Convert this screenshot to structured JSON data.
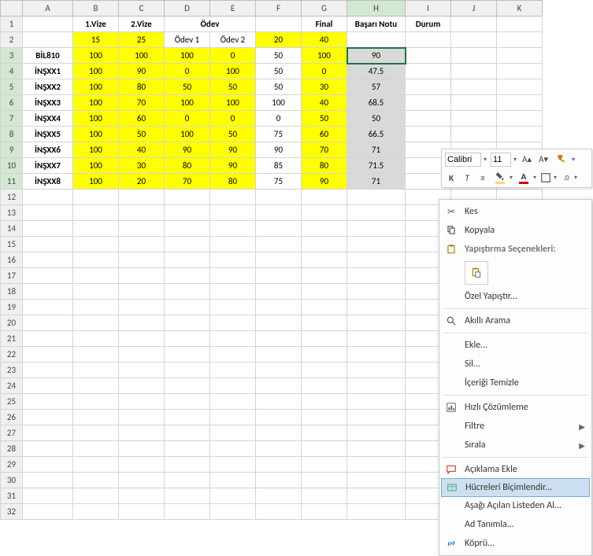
{
  "columns": [
    "A",
    "B",
    "C",
    "D",
    "E",
    "F",
    "G",
    "H",
    "I",
    "J",
    "K"
  ],
  "row_count": 32,
  "headers": {
    "A_blank": "",
    "vize1": "1.Vize",
    "vize2": "2.Vize",
    "odev": "Ödev",
    "final": "Final",
    "basari": "Başarı Notu",
    "durum": "Durum",
    "weight_v1": "15",
    "weight_v2": "25",
    "odev1": "Ödev 1",
    "odev2": "Ödev 2",
    "weight_o": "20",
    "weight_f": "40"
  },
  "rows": [
    {
      "id": "BİL810",
      "v1": "100",
      "v2": "100",
      "o1": "100",
      "o2": "0",
      "f": "50",
      "g": "100",
      "h": "90"
    },
    {
      "id": "İNŞXX1",
      "v1": "100",
      "v2": "90",
      "o1": "0",
      "o2": "100",
      "f": "50",
      "g": "0",
      "h": "47.5"
    },
    {
      "id": "İNŞXX2",
      "v1": "100",
      "v2": "80",
      "o1": "50",
      "o2": "50",
      "f": "50",
      "g": "30",
      "h": "57"
    },
    {
      "id": "İNŞXX3",
      "v1": "100",
      "v2": "70",
      "o1": "100",
      "o2": "100",
      "f": "100",
      "g": "40",
      "h": "68.5"
    },
    {
      "id": "İNŞXX4",
      "v1": "100",
      "v2": "60",
      "o1": "0",
      "o2": "0",
      "f": "0",
      "g": "50",
      "h": "50"
    },
    {
      "id": "İNŞXX5",
      "v1": "100",
      "v2": "50",
      "o1": "100",
      "o2": "50",
      "f": "75",
      "g": "60",
      "h": "66.5"
    },
    {
      "id": "İNŞXX6",
      "v1": "100",
      "v2": "40",
      "o1": "90",
      "o2": "90",
      "f": "90",
      "g": "70",
      "h": "71"
    },
    {
      "id": "İNŞXX7",
      "v1": "100",
      "v2": "30",
      "o1": "80",
      "o2": "90",
      "f": "85",
      "g": "80",
      "h": "71.5"
    },
    {
      "id": "İNŞXX8",
      "v1": "100",
      "v2": "20",
      "o1": "70",
      "o2": "80",
      "f": "75",
      "g": "90",
      "h": "71"
    }
  ],
  "mini_toolbar": {
    "font_name": "Calibri",
    "font_size": "11",
    "bold": "K",
    "italic": "T"
  },
  "context_menu": {
    "cut": "Kes",
    "copy": "Kopyala",
    "paste_section": "Yapıştırma Seçenekleri:",
    "paste_special": "Özel Yapıştır...",
    "smart_lookup": "Akıllı Arama",
    "insert": "Ekle...",
    "delete": "Sil...",
    "clear": "İçeriği Temizle",
    "quick_analysis": "Hızlı Çözümleme",
    "filter": "Filtre",
    "sort": "Sırala",
    "comment": "Açıklama Ekle",
    "format_cells": "Hücreleri Biçimlendir...",
    "dropdown": "Aşağı Açılan Listeden Al...",
    "define_name": "Ad Tanımla...",
    "hyperlink": "Köprü..."
  },
  "selection": {
    "col": "H",
    "rows": [
      3,
      4,
      5,
      6,
      7,
      8,
      9,
      10,
      11
    ]
  }
}
